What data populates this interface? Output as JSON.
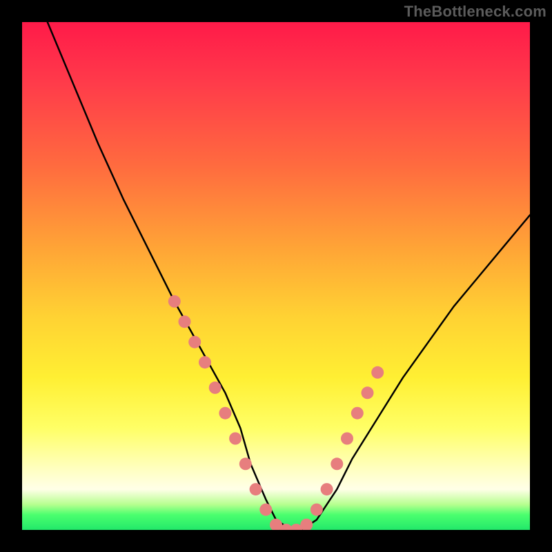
{
  "watermark": "TheBottleneck.com",
  "chart_data": {
    "type": "line",
    "title": "",
    "xlabel": "",
    "ylabel": "",
    "xlim": [
      0,
      100
    ],
    "ylim": [
      0,
      100
    ],
    "series": [
      {
        "name": "bottleneck-curve",
        "x": [
          5,
          10,
          15,
          20,
          25,
          30,
          35,
          40,
          43,
          45,
          48,
          50,
          53,
          55,
          58,
          62,
          65,
          70,
          75,
          80,
          85,
          90,
          95,
          100
        ],
        "values": [
          100,
          88,
          76,
          65,
          55,
          45,
          36,
          27,
          20,
          13,
          6,
          2,
          0,
          0,
          2,
          8,
          14,
          22,
          30,
          37,
          44,
          50,
          56,
          62
        ]
      }
    ],
    "markers": {
      "name": "sample-points",
      "x": [
        30,
        32,
        34,
        36,
        38,
        40,
        42,
        44,
        46,
        48,
        50,
        52,
        54,
        56,
        58,
        60,
        62,
        64,
        66,
        68,
        70
      ],
      "values": [
        45,
        41,
        37,
        33,
        28,
        23,
        18,
        13,
        8,
        4,
        1,
        0,
        0,
        1,
        4,
        8,
        13,
        18,
        23,
        27,
        31
      ],
      "radius": 9,
      "fill": "#e77e7e"
    },
    "background_gradient": {
      "top": "#ff1a49",
      "bottom": "#22e86a"
    }
  }
}
